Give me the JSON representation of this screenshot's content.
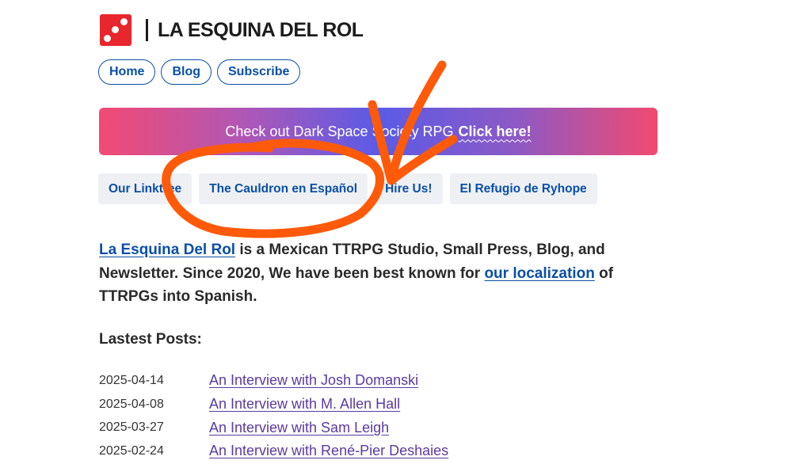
{
  "header": {
    "site_title": "LA ESQUINA DEL ROL",
    "logo_icon": "red-dice-icon",
    "logo_color": "#e8262d"
  },
  "nav": {
    "items": [
      {
        "label": "Home"
      },
      {
        "label": "Blog"
      },
      {
        "label": "Subscribe"
      }
    ]
  },
  "banner": {
    "text": "Check out Dark Space Society RPG",
    "cta": "Click here!"
  },
  "links": {
    "items": [
      {
        "label": "Our Linktree"
      },
      {
        "label": "The Cauldron en Español"
      },
      {
        "label": "Hire Us!"
      },
      {
        "label": "El Refugio de Ryhope"
      }
    ]
  },
  "intro": {
    "brand_link": "La Esquina Del Rol",
    "text_1": " is a Mexican TTRPG Studio, Small Press, Blog, and Newsletter. Since 2020, We have been best known for ",
    "localization_link": "our localization",
    "text_2": " of TTRPGs into Spanish."
  },
  "posts": {
    "heading": "Lastest Posts:",
    "items": [
      {
        "date": "2025-04-14",
        "title": "An Interview with Josh Domanski"
      },
      {
        "date": "2025-04-08",
        "title": "An Interview with M. Allen Hall"
      },
      {
        "date": "2025-03-27",
        "title": "An Interview with Sam Leigh"
      },
      {
        "date": "2025-02-24",
        "title": "An Interview with René-Pier Deshaies"
      }
    ]
  },
  "annotation": {
    "color": "#ff5a0a",
    "shapes": [
      "circle-annotation",
      "check-mark-annotation"
    ]
  }
}
